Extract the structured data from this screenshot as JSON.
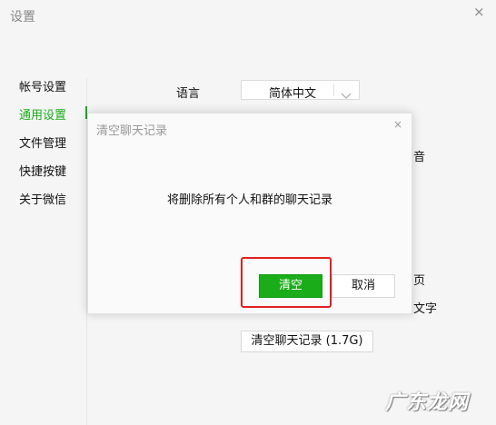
{
  "window": {
    "title": "设置",
    "close_glyph": "×"
  },
  "sidebar": {
    "items": [
      {
        "label": "帐号设置"
      },
      {
        "label": "通用设置"
      },
      {
        "label": "文件管理"
      },
      {
        "label": "快捷按键"
      },
      {
        "label": "关于微信"
      }
    ],
    "active_index": 1
  },
  "general": {
    "language_label": "语言",
    "language_value": "简体中文",
    "partial_right_1": "音",
    "partial_right_2": "页",
    "partial_right_3": "文字",
    "clear_history_button": "清空聊天记录 (1.7G)"
  },
  "dialog": {
    "title": "清空聊天记录",
    "close_glyph": "×",
    "message": "将删除所有个人和群的聊天记录",
    "confirm_label": "清空",
    "cancel_label": "取消"
  },
  "watermark": {
    "text": "广东龙网"
  },
  "colors": {
    "accent": "#1aad19",
    "highlight": "#e02020",
    "background": "#f5f5f5"
  }
}
